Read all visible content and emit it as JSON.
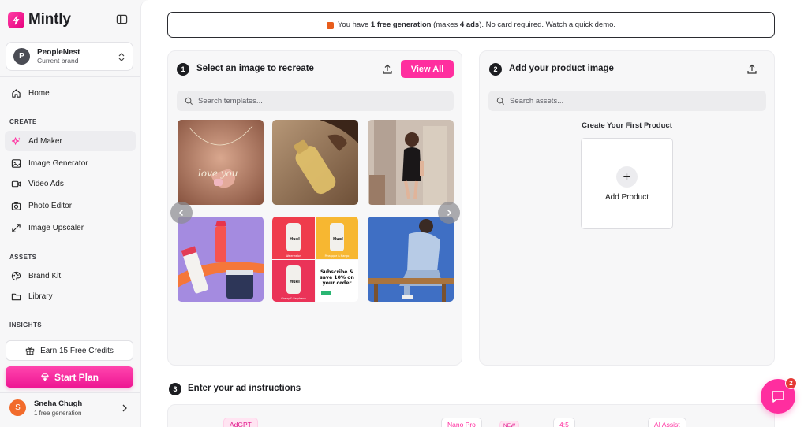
{
  "app": {
    "name": "Mintly",
    "brand_color": "#ff2e9f"
  },
  "brand": {
    "initial": "P",
    "name": "PeopleNest",
    "subtitle": "Current brand"
  },
  "nav": {
    "home": "Home",
    "create_label": "CREATE",
    "create_items": [
      "Ad Maker",
      "Image Generator",
      "Video Ads",
      "Photo Editor",
      "Image Upscaler"
    ],
    "assets_label": "ASSETS",
    "assets_items": [
      "Brand Kit",
      "Library"
    ],
    "insights_label": "INSIGHTS"
  },
  "earn_credits": "Earn 15 Free Credits",
  "start_plan": "Start Plan",
  "user": {
    "initial": "S",
    "name": "Sneha Chugh",
    "subtitle": "1 free generation"
  },
  "banner": {
    "prefix": "You have",
    "strong1": "1 free generation",
    "middle": "(makes",
    "strong2": "4 ads",
    "after": "). No card required.",
    "link": "Watch a quick demo",
    "end": "."
  },
  "step1": {
    "number": "1",
    "title": "Select an image to recreate",
    "view_all": "View All",
    "search_placeholder": "Search templates...",
    "tile_text": {
      "necklace": "love you",
      "bottle_label": "Huel",
      "tile_flavor_1": "Watermelon",
      "tile_flavor_2": "Pineapple & Mango",
      "tile_flavor_3": "Cherry & Raspberry",
      "subscribe": [
        "Subscribe &",
        "save 10% on",
        "your order"
      ]
    }
  },
  "step2": {
    "number": "2",
    "title": "Add your product image",
    "search_placeholder": "Search assets...",
    "create_title": "Create Your First Product",
    "add_product": "Add Product"
  },
  "step3": {
    "number": "3",
    "title": "Enter your ad instructions"
  },
  "toolbar_chips": [
    "AdGPT",
    "Nano Pro",
    "NEW",
    "4:5",
    "AI Assist"
  ],
  "chat": {
    "badge": "2"
  }
}
